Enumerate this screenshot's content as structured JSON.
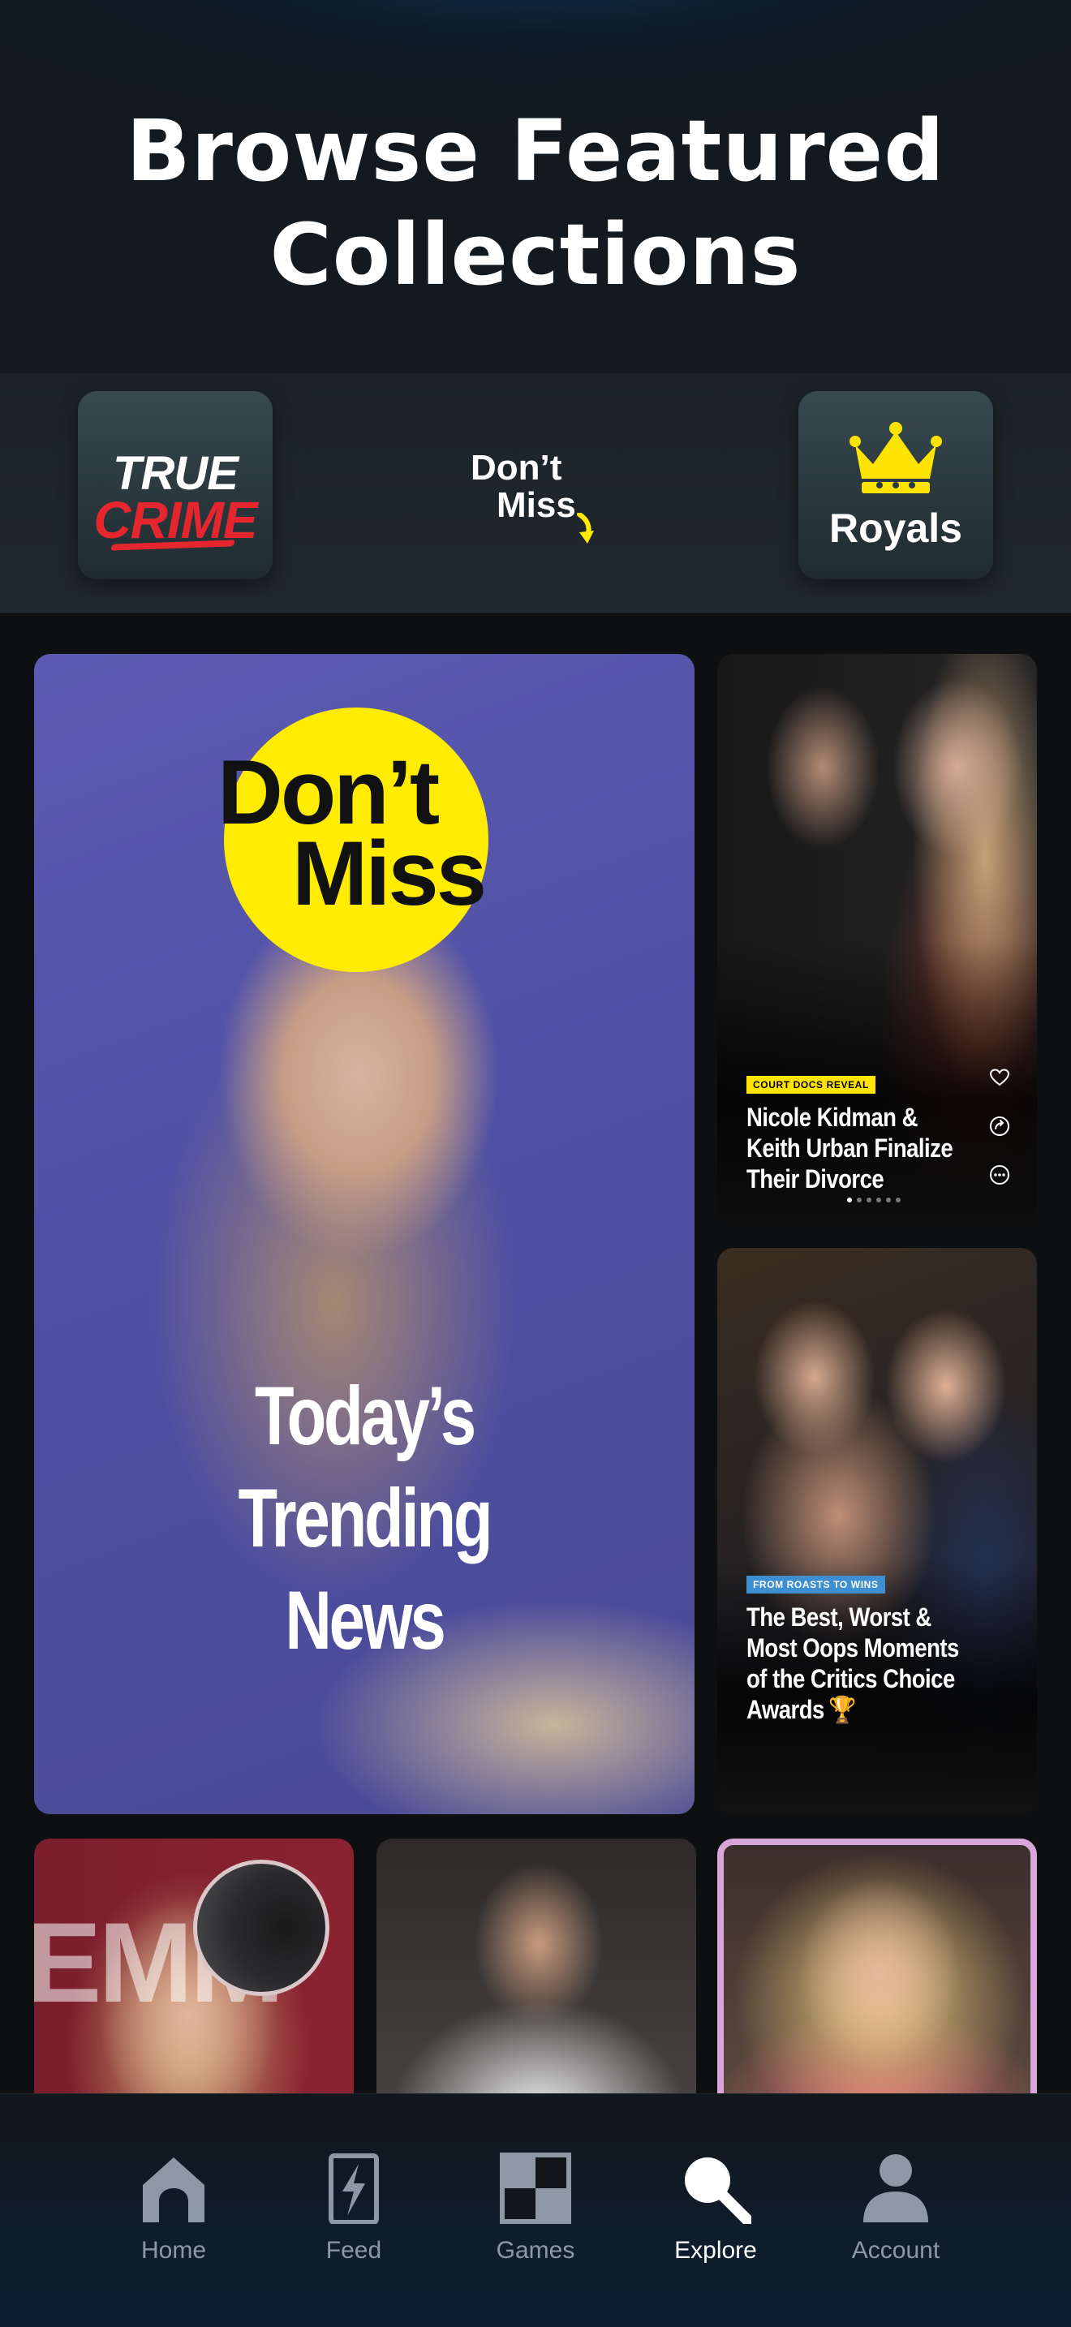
{
  "header": {
    "title_line1": "Browse Featured",
    "title_line2": "Collections"
  },
  "collections": [
    {
      "name": "true-crime",
      "line1": "TRUE",
      "line2": "CRIME"
    },
    {
      "name": "dont-miss",
      "line1": "Don’t",
      "line2": "Miss"
    },
    {
      "name": "royals",
      "label": "Royals"
    }
  ],
  "featured": {
    "badge_line1": "Don’t",
    "badge_line2": "Miss",
    "headline_line1": "Today’s",
    "headline_line2": "Trending",
    "headline_line3": "News"
  },
  "stories": [
    {
      "tag": "COURT DOCS REVEAL",
      "title_line1": "Nicole Kidman &",
      "title_line2": "Keith Urban Finalize",
      "title_line3": "Their Divorce",
      "actions": [
        "heart-icon",
        "share-icon",
        "more-icon"
      ]
    },
    {
      "tag": "FROM ROASTS TO WINS",
      "title_line1": "The Best, Worst &",
      "title_line2": "Most Oops Moments",
      "title_line3": "of the Critics Choice",
      "title_line4": "Awards",
      "title_emoji": "🏆"
    }
  ],
  "bottom_cards": {
    "amanda_bg_text": "EMM"
  },
  "tabbar": {
    "items": [
      {
        "label": "Home",
        "icon": "home-icon"
      },
      {
        "label": "Feed",
        "icon": "feed-icon"
      },
      {
        "label": "Games",
        "icon": "games-icon"
      },
      {
        "label": "Explore",
        "icon": "search-icon",
        "active": true
      },
      {
        "label": "Account",
        "icon": "account-icon"
      }
    ]
  },
  "colors": {
    "accent_yellow": "#ffec00",
    "true_crime_red": "#e6262f",
    "tag_blue": "#3d8fd0",
    "tab_inactive": "#8d98a4"
  }
}
